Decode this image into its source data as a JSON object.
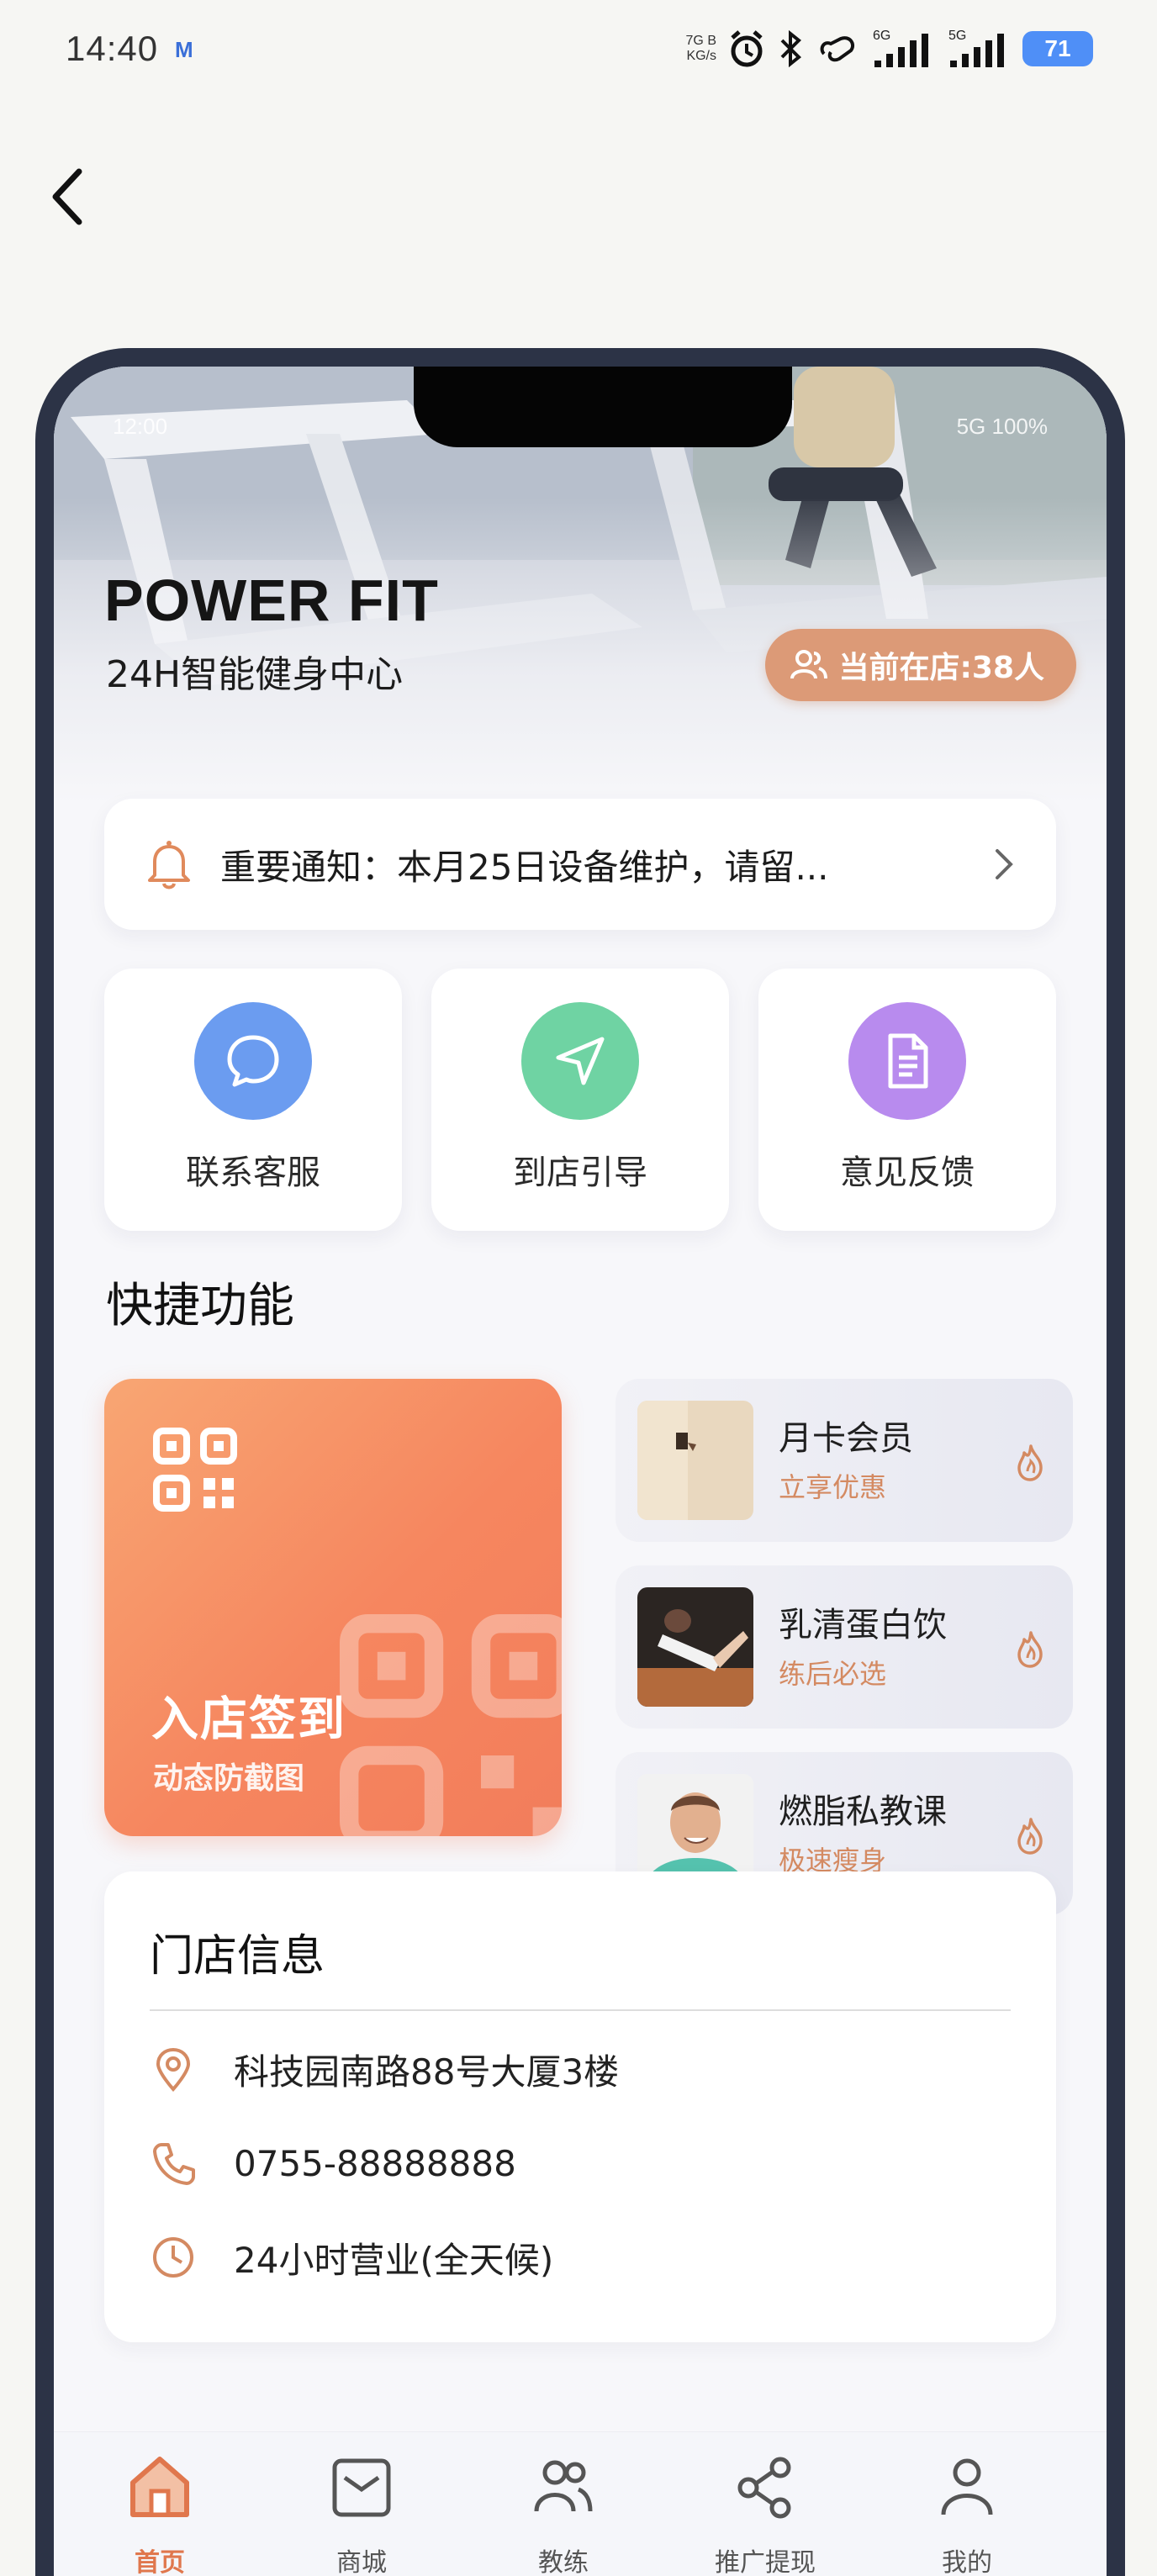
{
  "os_status": {
    "time": "14:40",
    "notif_icon": "M",
    "net_speed_line1": "7G B",
    "net_speed_line2": "KG/s",
    "signal1_label": "6G",
    "signal2_label": "5G",
    "battery": "71"
  },
  "inner_status": {
    "time": "12:00",
    "signal": "5G 100%"
  },
  "hero": {
    "title": "POWER FIT",
    "subtitle": "24H智能健身中心",
    "occupancy": "当前在店:38人"
  },
  "notice": {
    "text": "重要通知：本月25日设备维护，请留..."
  },
  "services": [
    {
      "label": "联系客服",
      "icon": "chat-icon",
      "color": "#6b9cf0"
    },
    {
      "label": "到店引导",
      "icon": "navigate-icon",
      "color": "#6fd3a3"
    },
    {
      "label": "意见反馈",
      "icon": "document-icon",
      "color": "#b88bee"
    }
  ],
  "quick": {
    "title": "快捷功能",
    "checkin": {
      "title": "入店签到",
      "subtitle": "动态防截图"
    },
    "promos": [
      {
        "name": "月卡会员",
        "sub": "立享优惠"
      },
      {
        "name": "乳清蛋白饮",
        "sub": "练后必选"
      },
      {
        "name": "燃脂私教课",
        "sub": "极速瘦身"
      }
    ]
  },
  "store": {
    "title": "门店信息",
    "address": "科技园南路88号大厦3楼",
    "phone": "0755-88888888",
    "hours": "24小时营业(全天候)"
  },
  "tabs": [
    {
      "label": "首页",
      "active": true
    },
    {
      "label": "商城",
      "active": false
    },
    {
      "label": "教练",
      "active": false
    },
    {
      "label": "推广提现",
      "active": false
    },
    {
      "label": "我的",
      "active": false
    }
  ],
  "colors": {
    "accent": "#e0774d",
    "pill": "#dc9a77",
    "frame": "#2c3346"
  }
}
